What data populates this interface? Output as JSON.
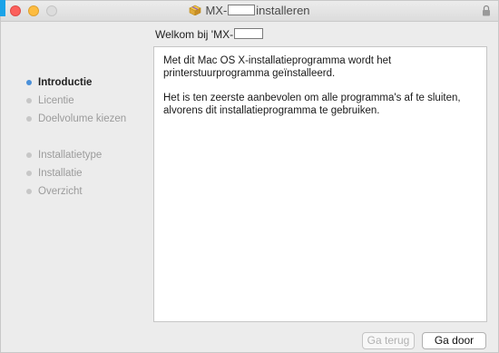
{
  "window": {
    "title_prefix": "MX-",
    "title_suffix": "installeren"
  },
  "heading": {
    "text": "Welkom bij 'MX-"
  },
  "sidebar": {
    "items": [
      {
        "label": "Introductie",
        "active": true
      },
      {
        "label": "Licentie",
        "active": false
      },
      {
        "label": "Doelvolume kiezen",
        "active": false
      },
      {
        "label": "Installatietype",
        "active": false
      },
      {
        "label": "Installatie",
        "active": false
      },
      {
        "label": "Overzicht",
        "active": false
      }
    ]
  },
  "content": {
    "paragraph_1": "Met dit Mac OS X-installatieprogramma wordt het printerstuurprogramma geïnstalleerd.",
    "paragraph_2": "Het is ten zeerste aanbevolen om alle programma's af te sluiten, alvorens dit installatieprogramma te gebruiken."
  },
  "buttons": {
    "back_label": "Ga terug",
    "next_label": "Ga door"
  },
  "icons": {
    "title_icon": "package-icon",
    "lock_icon": "lock-icon"
  },
  "colors": {
    "active_dot": "#4a90d9",
    "close": "#fc605c",
    "minimize": "#fdbc40"
  }
}
